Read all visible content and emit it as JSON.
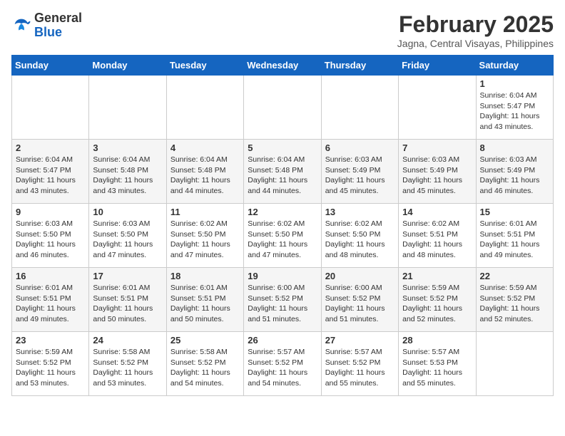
{
  "header": {
    "logo_general": "General",
    "logo_blue": "Blue",
    "month_title": "February 2025",
    "location": "Jagna, Central Visayas, Philippines"
  },
  "days_of_week": [
    "Sunday",
    "Monday",
    "Tuesday",
    "Wednesday",
    "Thursday",
    "Friday",
    "Saturday"
  ],
  "weeks": [
    [
      {
        "day": "",
        "info": ""
      },
      {
        "day": "",
        "info": ""
      },
      {
        "day": "",
        "info": ""
      },
      {
        "day": "",
        "info": ""
      },
      {
        "day": "",
        "info": ""
      },
      {
        "day": "",
        "info": ""
      },
      {
        "day": "1",
        "info": "Sunrise: 6:04 AM\nSunset: 5:47 PM\nDaylight: 11 hours\nand 43 minutes."
      }
    ],
    [
      {
        "day": "2",
        "info": "Sunrise: 6:04 AM\nSunset: 5:47 PM\nDaylight: 11 hours\nand 43 minutes."
      },
      {
        "day": "3",
        "info": "Sunrise: 6:04 AM\nSunset: 5:48 PM\nDaylight: 11 hours\nand 43 minutes."
      },
      {
        "day": "4",
        "info": "Sunrise: 6:04 AM\nSunset: 5:48 PM\nDaylight: 11 hours\nand 44 minutes."
      },
      {
        "day": "5",
        "info": "Sunrise: 6:04 AM\nSunset: 5:48 PM\nDaylight: 11 hours\nand 44 minutes."
      },
      {
        "day": "6",
        "info": "Sunrise: 6:03 AM\nSunset: 5:49 PM\nDaylight: 11 hours\nand 45 minutes."
      },
      {
        "day": "7",
        "info": "Sunrise: 6:03 AM\nSunset: 5:49 PM\nDaylight: 11 hours\nand 45 minutes."
      },
      {
        "day": "8",
        "info": "Sunrise: 6:03 AM\nSunset: 5:49 PM\nDaylight: 11 hours\nand 46 minutes."
      }
    ],
    [
      {
        "day": "9",
        "info": "Sunrise: 6:03 AM\nSunset: 5:50 PM\nDaylight: 11 hours\nand 46 minutes."
      },
      {
        "day": "10",
        "info": "Sunrise: 6:03 AM\nSunset: 5:50 PM\nDaylight: 11 hours\nand 47 minutes."
      },
      {
        "day": "11",
        "info": "Sunrise: 6:02 AM\nSunset: 5:50 PM\nDaylight: 11 hours\nand 47 minutes."
      },
      {
        "day": "12",
        "info": "Sunrise: 6:02 AM\nSunset: 5:50 PM\nDaylight: 11 hours\nand 47 minutes."
      },
      {
        "day": "13",
        "info": "Sunrise: 6:02 AM\nSunset: 5:50 PM\nDaylight: 11 hours\nand 48 minutes."
      },
      {
        "day": "14",
        "info": "Sunrise: 6:02 AM\nSunset: 5:51 PM\nDaylight: 11 hours\nand 48 minutes."
      },
      {
        "day": "15",
        "info": "Sunrise: 6:01 AM\nSunset: 5:51 PM\nDaylight: 11 hours\nand 49 minutes."
      }
    ],
    [
      {
        "day": "16",
        "info": "Sunrise: 6:01 AM\nSunset: 5:51 PM\nDaylight: 11 hours\nand 49 minutes."
      },
      {
        "day": "17",
        "info": "Sunrise: 6:01 AM\nSunset: 5:51 PM\nDaylight: 11 hours\nand 50 minutes."
      },
      {
        "day": "18",
        "info": "Sunrise: 6:01 AM\nSunset: 5:51 PM\nDaylight: 11 hours\nand 50 minutes."
      },
      {
        "day": "19",
        "info": "Sunrise: 6:00 AM\nSunset: 5:52 PM\nDaylight: 11 hours\nand 51 minutes."
      },
      {
        "day": "20",
        "info": "Sunrise: 6:00 AM\nSunset: 5:52 PM\nDaylight: 11 hours\nand 51 minutes."
      },
      {
        "day": "21",
        "info": "Sunrise: 5:59 AM\nSunset: 5:52 PM\nDaylight: 11 hours\nand 52 minutes."
      },
      {
        "day": "22",
        "info": "Sunrise: 5:59 AM\nSunset: 5:52 PM\nDaylight: 11 hours\nand 52 minutes."
      }
    ],
    [
      {
        "day": "23",
        "info": "Sunrise: 5:59 AM\nSunset: 5:52 PM\nDaylight: 11 hours\nand 53 minutes."
      },
      {
        "day": "24",
        "info": "Sunrise: 5:58 AM\nSunset: 5:52 PM\nDaylight: 11 hours\nand 53 minutes."
      },
      {
        "day": "25",
        "info": "Sunrise: 5:58 AM\nSunset: 5:52 PM\nDaylight: 11 hours\nand 54 minutes."
      },
      {
        "day": "26",
        "info": "Sunrise: 5:57 AM\nSunset: 5:52 PM\nDaylight: 11 hours\nand 54 minutes."
      },
      {
        "day": "27",
        "info": "Sunrise: 5:57 AM\nSunset: 5:52 PM\nDaylight: 11 hours\nand 55 minutes."
      },
      {
        "day": "28",
        "info": "Sunrise: 5:57 AM\nSunset: 5:53 PM\nDaylight: 11 hours\nand 55 minutes."
      },
      {
        "day": "",
        "info": ""
      }
    ]
  ]
}
